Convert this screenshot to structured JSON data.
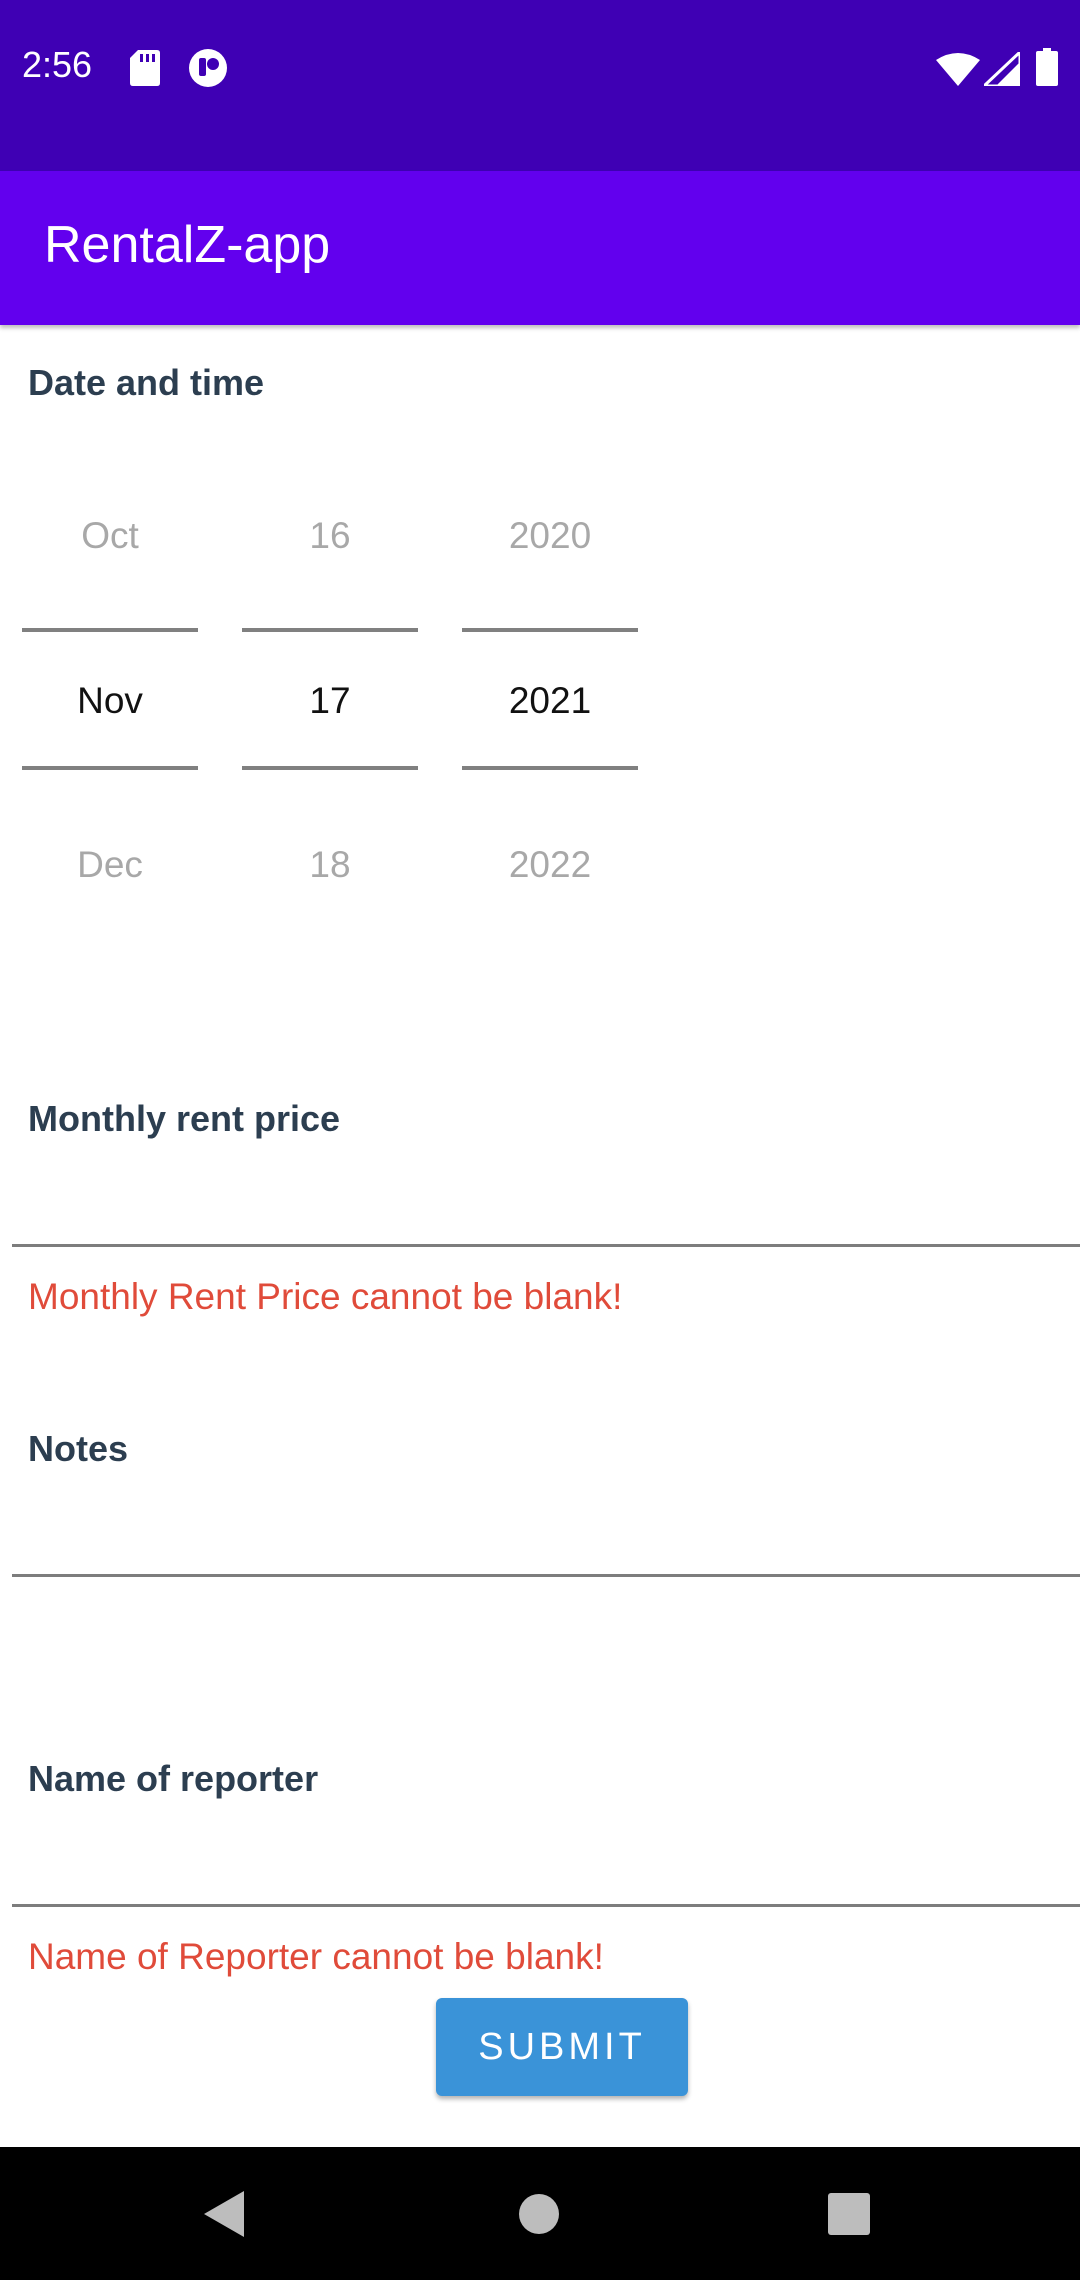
{
  "status_bar": {
    "time": "2:56",
    "icons": [
      "sd-card-icon",
      "app-notification-icon",
      "wifi-icon",
      "signal-icon",
      "battery-icon"
    ]
  },
  "app_bar": {
    "title": "RentalZ-app"
  },
  "date_section": {
    "label": "Date and time",
    "month": {
      "prev": "Oct",
      "selected": "Nov",
      "next": "Dec"
    },
    "day": {
      "prev": "16",
      "selected": "17",
      "next": "18"
    },
    "year": {
      "prev": "2020",
      "selected": "2021",
      "next": "2022"
    }
  },
  "rent_section": {
    "label": "Monthly rent price",
    "value": "",
    "error": "Monthly Rent Price cannot be blank!"
  },
  "notes_section": {
    "label": "Notes",
    "value": ""
  },
  "reporter_section": {
    "label": "Name of reporter",
    "value": "",
    "error": "Name of Reporter cannot be blank!"
  },
  "submit": {
    "label": "SUBMIT"
  },
  "colors": {
    "status_bar": "#3f00b4",
    "app_bar": "#6200ee",
    "label": "#2c3e50",
    "error": "#e04b3a",
    "button": "#3a93d8"
  }
}
